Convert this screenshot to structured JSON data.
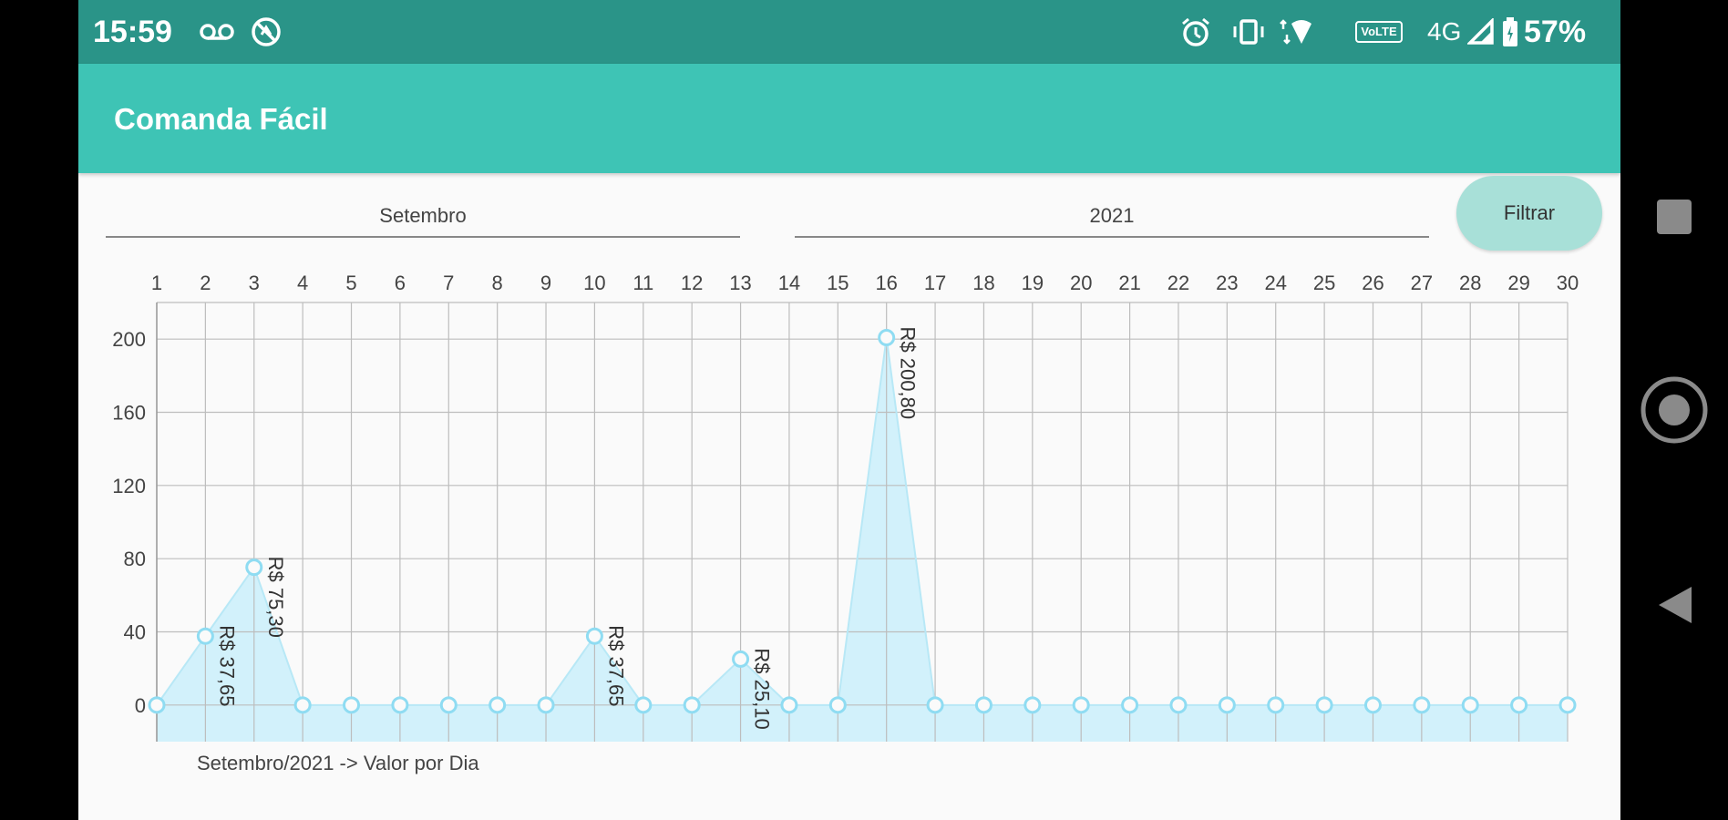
{
  "status_bar": {
    "time": "15:59",
    "battery": "57%",
    "network": "4G",
    "volte": "VoLTE",
    "icons": [
      "voicemail-icon",
      "blocked-icon",
      "alarm-icon",
      "vibrate-icon",
      "wifi-icon",
      "volte-icon",
      "signal-icon",
      "battery-icon"
    ]
  },
  "app_bar": {
    "title": "Comanda Fácil"
  },
  "filters": {
    "month": "Setembro",
    "year": "2021",
    "filter_button": "Filtrar"
  },
  "chart_data": {
    "type": "area",
    "x": [
      1,
      2,
      3,
      4,
      5,
      6,
      7,
      8,
      9,
      10,
      11,
      12,
      13,
      14,
      15,
      16,
      17,
      18,
      19,
      20,
      21,
      22,
      23,
      24,
      25,
      26,
      27,
      28,
      29,
      30
    ],
    "values": [
      0,
      37.65,
      75.3,
      0,
      0,
      0,
      0,
      0,
      0,
      37.65,
      0,
      0,
      25.1,
      0,
      0,
      200.8,
      0,
      0,
      0,
      0,
      0,
      0,
      0,
      0,
      0,
      0,
      0,
      0,
      0,
      0
    ],
    "value_labels": {
      "2": "R$ 37,65",
      "3": "R$ 75,30",
      "10": "R$ 37,65",
      "13": "R$ 25,10",
      "16": "R$ 200,80"
    },
    "y_ticks": [
      0,
      40,
      80,
      120,
      160,
      200
    ],
    "ylim": [
      -20,
      220
    ],
    "xlim": [
      1,
      30
    ],
    "x_axis_position": "top",
    "grid": true,
    "description": "Setembro/2021 -> Valor por Dia",
    "colors": {
      "fill": "#d2f1fb",
      "line": "#b8e8f6",
      "marker": "#8fdcf2",
      "grid": "#bdbdbd"
    }
  },
  "nav_bar": {
    "icons": [
      "recents-icon",
      "home-icon",
      "back-icon"
    ]
  }
}
